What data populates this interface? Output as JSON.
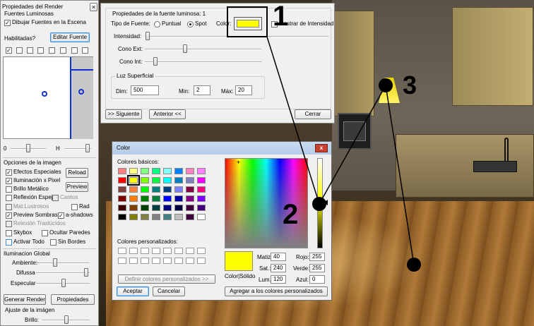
{
  "left_panel": {
    "title": "Propiedades del Render",
    "close": "×",
    "fuentes_group": "Fuentes Luminosas",
    "dibujar": "Dibujar Fuentes en la Escena",
    "habilitadas": "Habilitadas?",
    "editar": "Editar Fuente",
    "slider_left": "0",
    "slider_right": "H",
    "opciones": "Opciones de la imagen",
    "efectos": "Efectos Especiales",
    "reload": "Reload",
    "iluminacion": "Iluminación x Pixel",
    "preview_btn": "Preview",
    "brillo_metalico": "Brillo Metálico",
    "reflexion_espejos": "Reflexión Espejos",
    "cantos": "Cantos",
    "mat_lustrosos": "Mat.Lustrosos",
    "rad": "Rad",
    "preview_sombras": "Preview Sombras",
    "ashadows": "a-shadows",
    "reflexion_traslucidos": "Relexión Traslúcidos",
    "skybox": "Skybox",
    "ocultar_paredes": "Ocultar Paredes",
    "activar_todo": "Activar Todo",
    "sin_bordes": "Sin Bordes",
    "iluminacion_global": "Iluminacion Global",
    "ambiente": "Ambiente:",
    "difusa": "Difussa",
    "especular": "Especular",
    "generar": "Generar Render",
    "propiedades": "Propiedades",
    "ajuste": "Ajuste de la imágen",
    "brillo": "Brillo:"
  },
  "source_dialog": {
    "title": "Propiedades de la fuente luminosa: 1",
    "tipo": "Tipo de Fuente:",
    "puntual": "Puntual",
    "spot": "Spot",
    "color": "Color:",
    "mostrar": "Mostrar de Intensidad",
    "intensidad": "Intensidad:",
    "cono_ext": "Cono Ext:",
    "cono_int": "Cono Int:",
    "luz_superficial": "Luz Superficial",
    "dim_label": "Dim:",
    "dim_value": "500",
    "min_label": "Min:",
    "min_value": "2",
    "max_label": "Máx:",
    "max_value": "20",
    "siguiente": ">> Siguiente",
    "anterior": "Anterior <<",
    "cerrar": "Cerrar",
    "current_color": "#ffff00"
  },
  "color_dialog": {
    "title": "Color",
    "close": "x",
    "basicos": "Colores básicos:",
    "personalizados": "Colores personalizados:",
    "definir": "Definir colores personalizados >>",
    "aceptar": "Aceptar",
    "cancelar": "Cancelar",
    "color_solido": "Color|Sólido",
    "matiz_label": "Matiz:",
    "matiz": "40",
    "sat_label": "Sat.:",
    "sat": "240",
    "lum_label": "Lum.:",
    "lum": "120",
    "rojo_label": "Rojo:",
    "rojo": "255",
    "verde_label": "Verde:",
    "verde": "255",
    "azul_label": "Azul:",
    "azul": "0",
    "agregar": "Agregar a los colores personalizados",
    "basic_colors": [
      "#ff8080",
      "#ffff80",
      "#80ff80",
      "#00ff80",
      "#80ffff",
      "#0080ff",
      "#ff80c0",
      "#ff80ff",
      "#ff0000",
      "#ffff00",
      "#80ff00",
      "#00ff40",
      "#00ffff",
      "#0080c0",
      "#8080c0",
      "#ff00ff",
      "#804040",
      "#ff8040",
      "#00ff00",
      "#008080",
      "#004080",
      "#8080ff",
      "#800040",
      "#ff0080",
      "#800000",
      "#ff8000",
      "#008000",
      "#008040",
      "#0000ff",
      "#0000a0",
      "#800080",
      "#8000ff",
      "#400000",
      "#804000",
      "#004000",
      "#004040",
      "#000080",
      "#000040",
      "#400040",
      "#400080",
      "#000000",
      "#808000",
      "#808040",
      "#808080",
      "#408080",
      "#c0c0c0",
      "#400040",
      "#ffffff"
    ],
    "selected_index": 9
  },
  "annotations": {
    "one": "1",
    "two": "2",
    "three": "3"
  }
}
